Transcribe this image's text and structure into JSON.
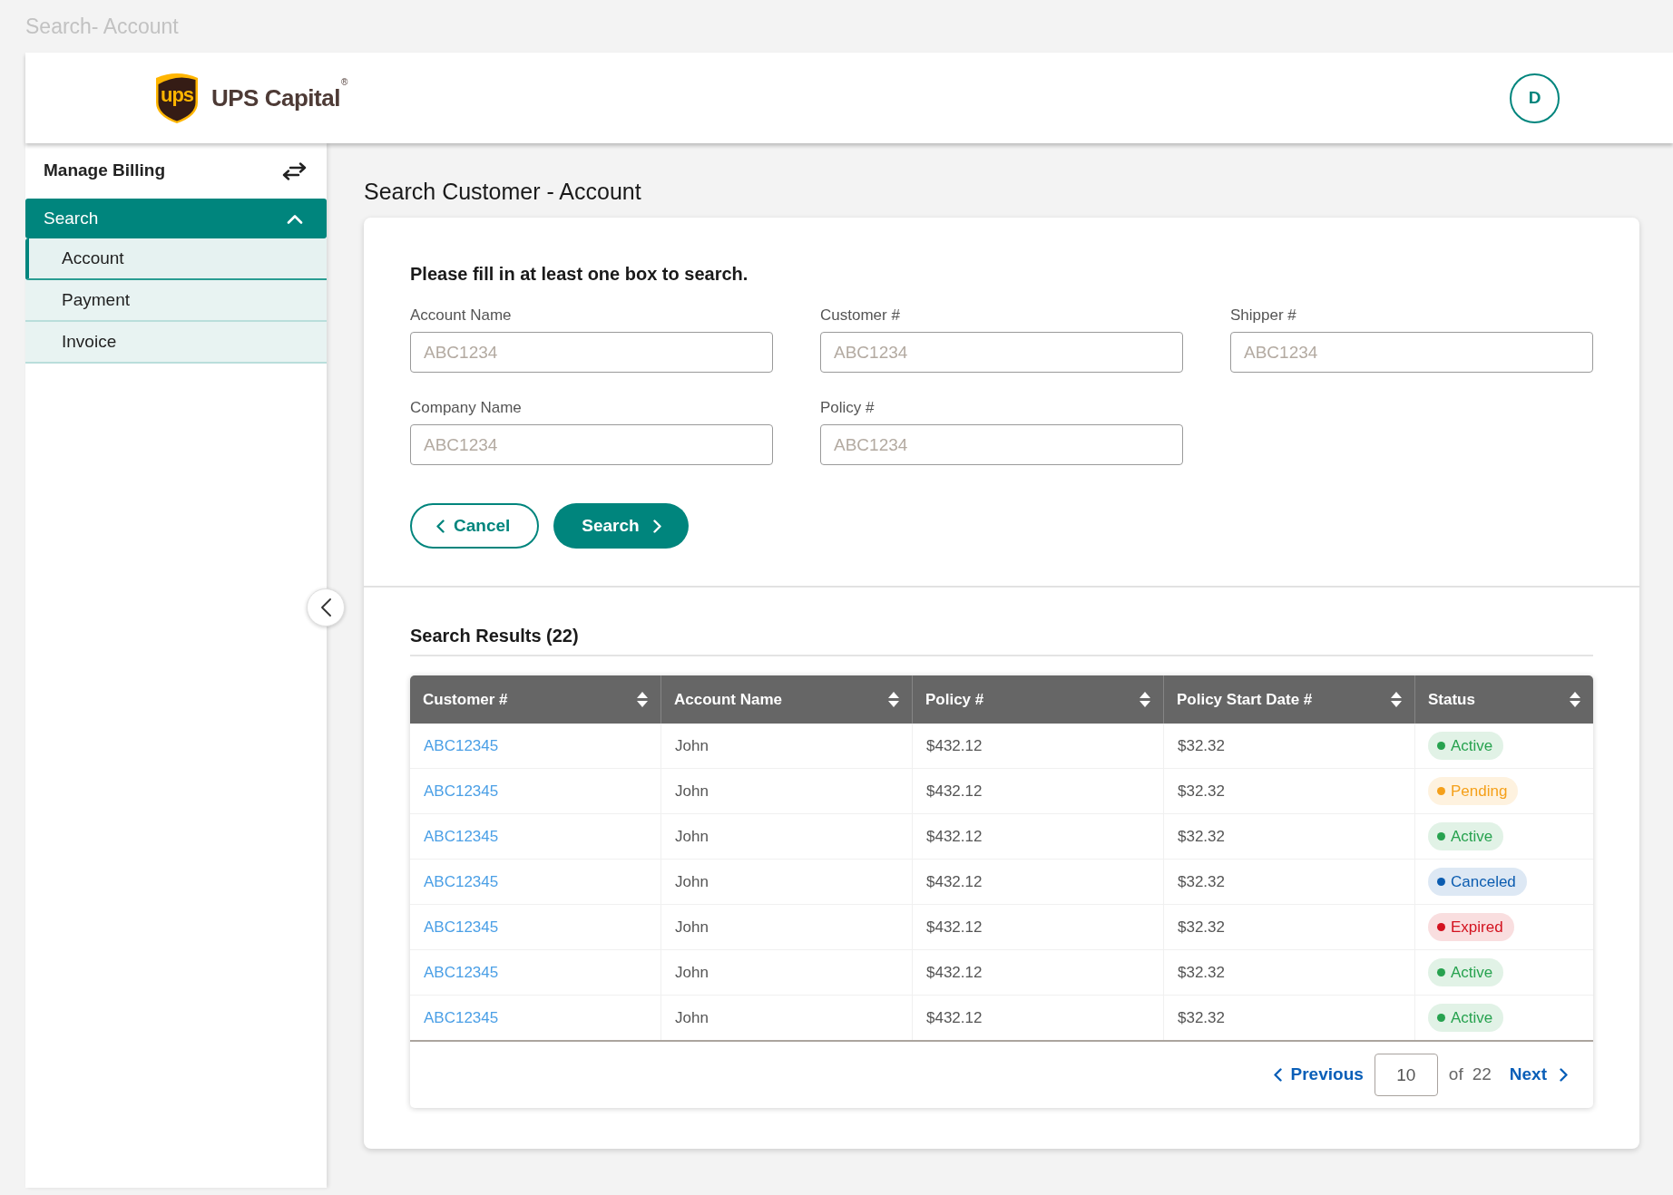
{
  "frame_title": "Search- Account",
  "header": {
    "brand": {
      "shield_text": "ups",
      "name": "UPS Capital",
      "mark": "®"
    },
    "avatar": "D"
  },
  "sidebar": {
    "title": "Manage Billing",
    "items": [
      {
        "label": "Search",
        "expanded": true,
        "children": [
          {
            "label": "Account",
            "selected": true
          },
          {
            "label": "Payment",
            "selected": false
          },
          {
            "label": "Invoice",
            "selected": false
          }
        ]
      }
    ]
  },
  "page_title": "Search Customer - Account",
  "search_form": {
    "instruction": "Please fill in at least one box to search.",
    "fields": [
      {
        "label": "Account Name",
        "placeholder": "ABC1234"
      },
      {
        "label": "Customer #",
        "placeholder": "ABC1234"
      },
      {
        "label": "Shipper #",
        "placeholder": "ABC1234"
      },
      {
        "label": "Company Name",
        "placeholder": "ABC1234"
      },
      {
        "label": "Policy #",
        "placeholder": "ABC1234"
      }
    ],
    "buttons": [
      {
        "label": "Cancel",
        "kind": "secondary"
      },
      {
        "label": "Search",
        "kind": "primary"
      }
    ]
  },
  "results": {
    "title": "Search Results (22)",
    "table": {
      "columns": [
        {
          "label": "Customer #",
          "kind": "link",
          "sortable": true
        },
        {
          "label": "Account Name",
          "kind": "text",
          "sortable": true
        },
        {
          "label": "Policy #",
          "kind": "text",
          "sortable": true
        },
        {
          "label": "Policy Start Date #",
          "kind": "text",
          "sortable": true
        },
        {
          "label": "Status",
          "kind": "status",
          "sortable": true
        }
      ],
      "rows": [
        {
          "cells": [
            "ABC12345",
            "John",
            "$432.12",
            "$32.32"
          ],
          "status": {
            "label": "Active",
            "color": "#27a24f"
          }
        },
        {
          "cells": [
            "ABC12345",
            "John",
            "$432.12",
            "$32.32"
          ],
          "status": {
            "label": "Pending",
            "color": "#f5a01a"
          }
        },
        {
          "cells": [
            "ABC12345",
            "John",
            "$432.12",
            "$32.32"
          ],
          "status": {
            "label": "Active",
            "color": "#27a24f"
          }
        },
        {
          "cells": [
            "ABC12345",
            "John",
            "$432.12",
            "$32.32"
          ],
          "status": {
            "label": "Canceled",
            "color": "#0b5cb0"
          }
        },
        {
          "cells": [
            "ABC12345",
            "John",
            "$432.12",
            "$32.32"
          ],
          "status": {
            "label": "Expired",
            "color": "#d3121f"
          }
        },
        {
          "cells": [
            "ABC12345",
            "John",
            "$432.12",
            "$32.32"
          ],
          "status": {
            "label": "Active",
            "color": "#27a24f"
          }
        },
        {
          "cells": [
            "ABC12345",
            "John",
            "$432.12",
            "$32.32"
          ],
          "status": {
            "label": "Active",
            "color": "#27a24f"
          }
        }
      ]
    },
    "pagination": {
      "previous": "Previous",
      "page": "10",
      "of": "of",
      "total": "22",
      "next": "Next"
    }
  }
}
